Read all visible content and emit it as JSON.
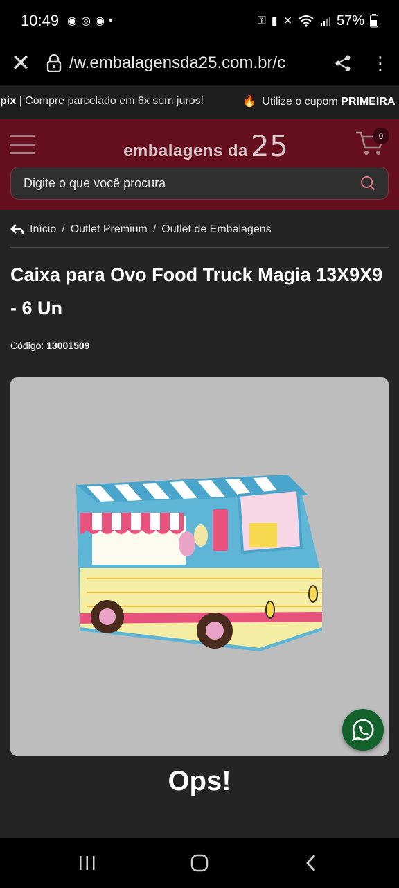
{
  "status_bar": {
    "time": "10:49",
    "battery": "57%",
    "left_icons": [
      "chrome-icon",
      "whatsapp-icon",
      "chrome-icon",
      "dot-icon"
    ],
    "right_icons": [
      "key-icon",
      "battery-saver-icon",
      "mute-icon",
      "wifi-icon",
      "signal-icon",
      "battery-icon"
    ]
  },
  "browser": {
    "url": "/w.embalagensda25.com.br/c"
  },
  "promo": {
    "segment1_bold": "pix",
    "segment1_text": " | Compre parcelado em 6x sem juros!",
    "segment2_text": " Utilize o cupom ",
    "segment2_bold": "PRIMEIRA"
  },
  "header": {
    "logo_text": "embalagens da",
    "logo_number": "25",
    "cart_count": "0",
    "search_placeholder": "Digite o que você procura"
  },
  "breadcrumb": {
    "items": [
      "Início",
      "Outlet Premium",
      "Outlet de Embalagens"
    ],
    "separator": "/"
  },
  "product": {
    "title": "Caixa para Ovo Food Truck Magia 13X9X9 - 6 Un",
    "code_label": "Código:",
    "code_value": "13001509"
  },
  "message": {
    "ops": "Ops!"
  },
  "colors": {
    "header_bg": "#650f1f",
    "page_bg": "#242424",
    "whatsapp": "#14622b"
  }
}
